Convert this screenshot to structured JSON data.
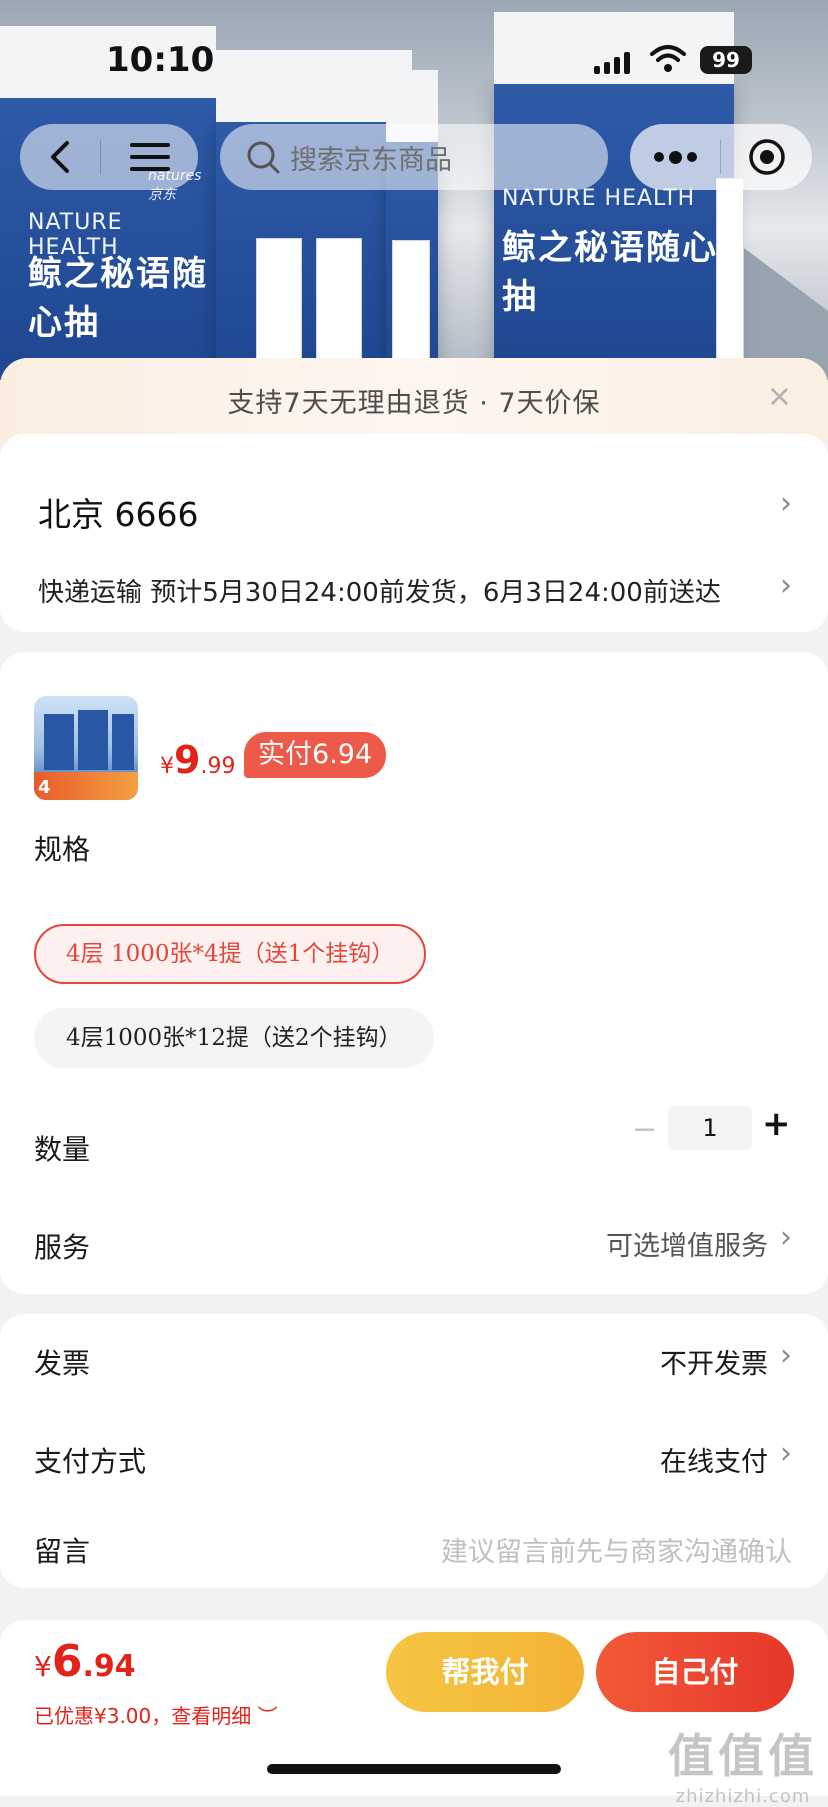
{
  "status_bar": {
    "time": "10:10",
    "battery": "99"
  },
  "nav": {
    "search_placeholder": "搜索京东商品"
  },
  "hero": {
    "brand": "natures 京东",
    "nature_health": "NATURE HEALTH",
    "product_cn": "鲸之秘语随心抽"
  },
  "banner": {
    "text": "支持7天无理由退货 · 7天价保",
    "close": "×"
  },
  "address": {
    "line1": "北京  6666",
    "shipping": "快递运输  预计5月30日24:00前发货，6月3日24:00前送达"
  },
  "product": {
    "currency": "¥",
    "price_int": "9",
    "price_dec": ".99",
    "actual_pay": "实付6.94",
    "thumb_badge": "4"
  },
  "spec": {
    "label": "规格",
    "options": [
      "4层 1000张*4提（送1个挂钩）",
      "4层1000张*12提（送2个挂钩）"
    ],
    "selected_index": 0
  },
  "quantity": {
    "label": "数量",
    "value": "1",
    "minus": "−",
    "plus": "+"
  },
  "service": {
    "label": "服务",
    "value": "可选增值服务"
  },
  "invoice": {
    "label": "发票",
    "value": "不开发票"
  },
  "payment": {
    "label": "支付方式",
    "value": "在线支付"
  },
  "message": {
    "label": "留言",
    "placeholder": "建议留言前先与商家沟通确认"
  },
  "bottom": {
    "currency": "¥",
    "total_int": "6",
    "total_dec": ".94",
    "discount": "已优惠¥3.00，查看明细 ︶",
    "help_pay": "帮我付",
    "self_pay": "自己付"
  },
  "watermark": {
    "main": "值值值",
    "sub": "zhizhizhi.com"
  },
  "colors": {
    "accent": "#e2231a",
    "help_btn": "#f5c542",
    "self_btn": "#e6372b"
  }
}
